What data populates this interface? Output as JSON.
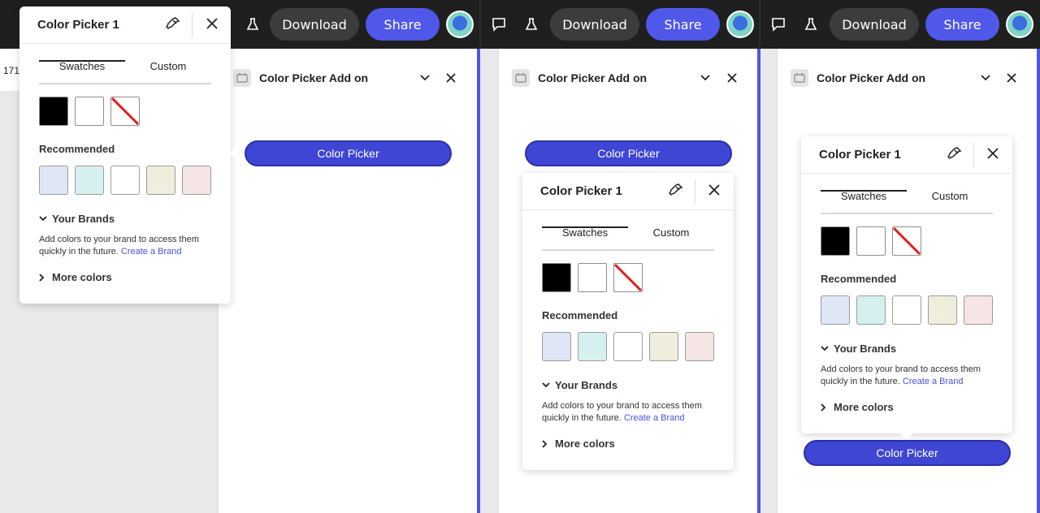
{
  "toolbar": {
    "download_label": "Download",
    "share_label": "Share"
  },
  "canvas": {
    "zoom_partial": "171"
  },
  "addon": {
    "title": "Color Picker Add on",
    "button_label": "Color Picker"
  },
  "picker": {
    "title": "Color Picker 1",
    "tabs": [
      "Swatches",
      "Custom"
    ],
    "recommended_label": "Recommended",
    "recommended_colors": [
      "#dfe6f5",
      "#d6f0f0",
      "#ffffff",
      "#efeddb",
      "#f5e5e5"
    ],
    "swatches": [
      "#000000",
      "#ffffff",
      "none"
    ],
    "brands_label": "Your Brands",
    "brands_text": "Add colors to your brand to access them quickly in the future.",
    "brands_link": "Create a Brand",
    "more_colors_label": "More colors"
  },
  "colors": {
    "accent": "#4f55e3",
    "button": "#4046d4"
  }
}
